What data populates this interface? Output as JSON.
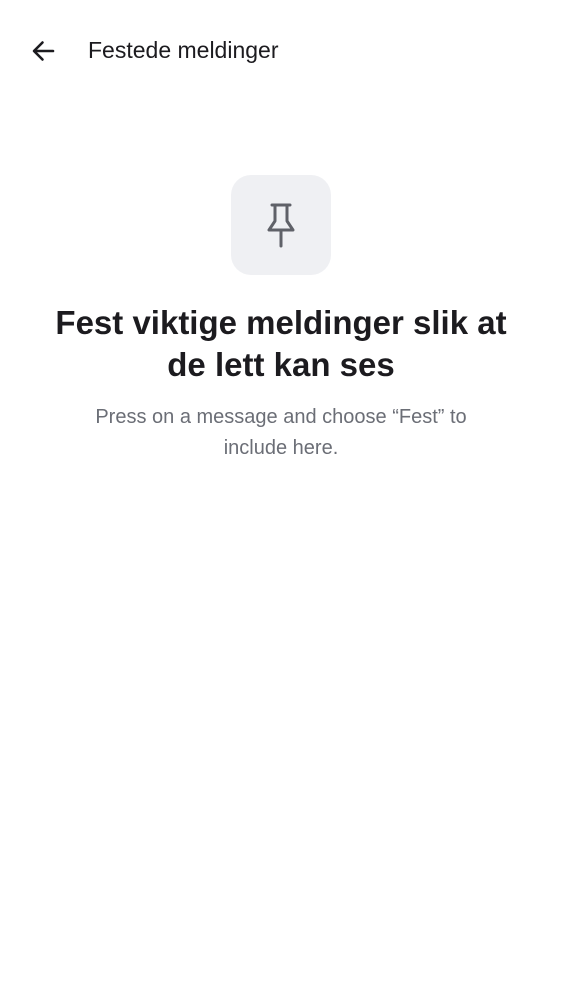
{
  "header": {
    "title": "Festede meldinger",
    "back_icon": "arrow-left-icon"
  },
  "empty_state": {
    "icon": "pin-icon",
    "heading": "Fest viktige meldinger slik at de lett kan ses",
    "subtext": "Press on a message and choose “Fest” to include here."
  },
  "colors": {
    "background": "#ffffff",
    "icon_tile": "#eff0f3",
    "icon_stroke": "#5f6168",
    "heading": "#1c1b1f",
    "subtext": "#6b6e76"
  }
}
